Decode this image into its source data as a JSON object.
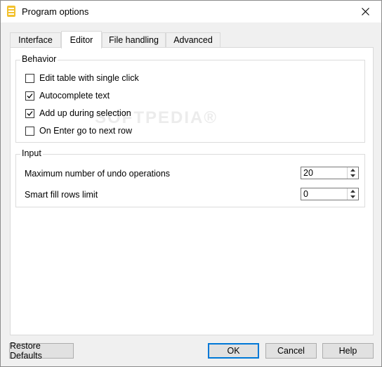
{
  "window": {
    "title": "Program options"
  },
  "tabs": [
    {
      "label": "Interface"
    },
    {
      "label": "Editor"
    },
    {
      "label": "File handling"
    },
    {
      "label": "Advanced"
    }
  ],
  "behavior": {
    "label": "Behavior",
    "options": [
      {
        "label": "Edit table with single click",
        "checked": false
      },
      {
        "label": "Autocomplete text",
        "checked": true
      },
      {
        "label": "Add up during selection",
        "checked": true
      },
      {
        "label": "On Enter go to next row",
        "checked": false
      }
    ]
  },
  "input": {
    "label": "Input",
    "fields": [
      {
        "label": "Maximum number of undo operations",
        "value": "20"
      },
      {
        "label": "Smart fill rows limit",
        "value": "0"
      }
    ]
  },
  "buttons": {
    "restore": "Restore Defaults",
    "ok": "OK",
    "cancel": "Cancel",
    "help": "Help"
  },
  "watermark": "SOFTPEDIA®",
  "colors": {
    "accent": "#0078d7",
    "app_icon": "#f2c12e"
  }
}
